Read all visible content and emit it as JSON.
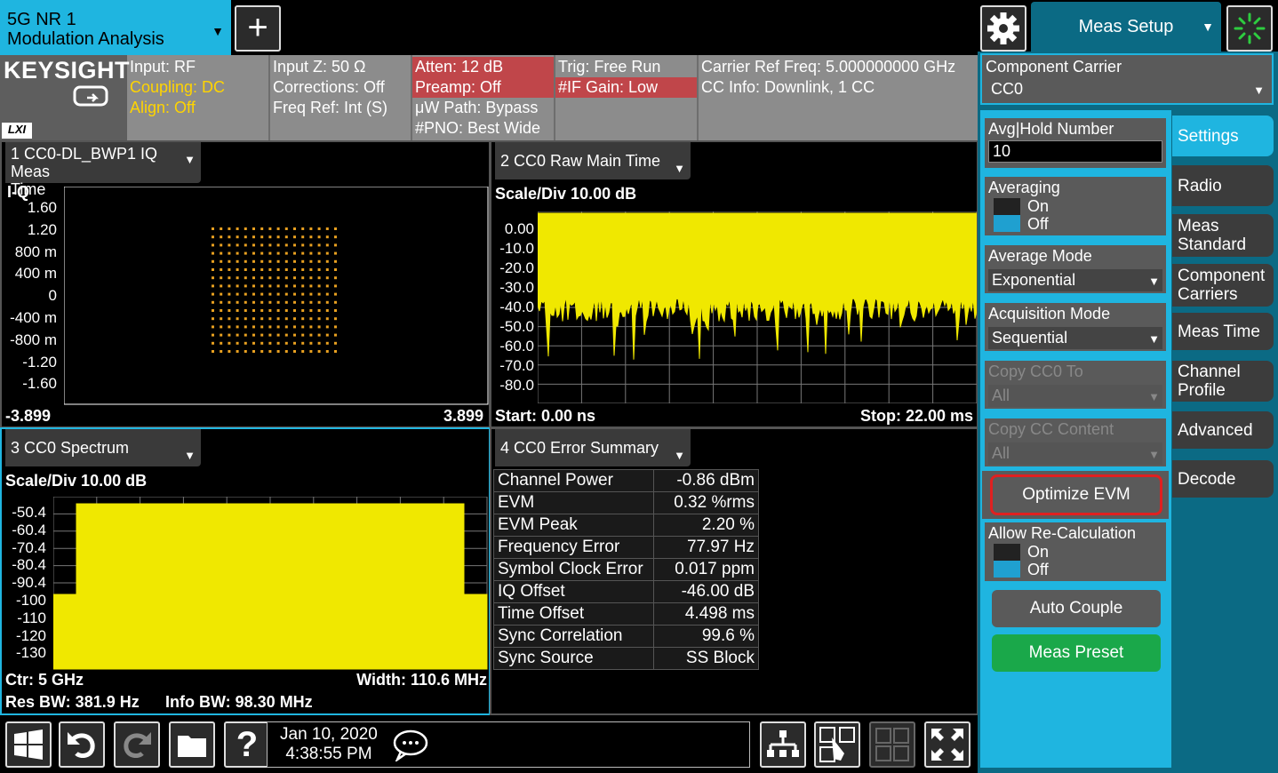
{
  "app": {
    "line1": "5G NR 1",
    "line2": "Modulation Analysis"
  },
  "header": {
    "meas_setup": "Meas Setup"
  },
  "logo": {
    "brand": "KEYSIGHT",
    "lxi": "LXI"
  },
  "info": {
    "input": "Input: RF",
    "coupling": "Coupling: DC",
    "align": "Align: Off",
    "input_z": "Input Z: 50 Ω",
    "corrections": "Corrections: Off",
    "freq_ref": "Freq Ref: Int (S)",
    "atten": "Atten: 12 dB",
    "preamp": "Preamp: Off",
    "uw_path": "μW Path: Bypass",
    "pno": "#PNO: Best Wide",
    "trig": "Trig: Free Run",
    "if_gain": "#IF Gain: Low",
    "carrier_ref": "Carrier Ref Freq: 5.000000000 GHz",
    "cc_info": "CC Info: Downlink, 1 CC"
  },
  "panel1": {
    "title1": "1 CC0-DL_BWP1  IQ Meas",
    "title2": "Time",
    "label": "I-Q",
    "yticks": [
      "1.60",
      "1.20",
      "800 m",
      "400 m",
      "0",
      "-400 m",
      "-800 m",
      "-1.20",
      "-1.60"
    ],
    "xmin": "-3.899",
    "xmax": "3.899"
  },
  "panel2": {
    "title": "2 CC0 Raw Main Time",
    "scale": "Scale/Div 10.00 dB",
    "yticks": [
      "0.00",
      "-10.0",
      "-20.0",
      "-30.0",
      "-40.0",
      "-50.0",
      "-60.0",
      "-70.0",
      "-80.0"
    ],
    "start": "Start: 0.00 ns",
    "stop": "Stop: 22.00 ms"
  },
  "panel3": {
    "title": "3 CC0 Spectrum",
    "scale": "Scale/Div 10.00 dB",
    "yticks": [
      "-50.4",
      "-60.4",
      "-70.4",
      "-80.4",
      "-90.4",
      "-100",
      "-110",
      "-120",
      "-130"
    ],
    "ctr": "Ctr: 5 GHz",
    "width": "Width: 110.6 MHz",
    "res_bw": "Res BW: 381.9 Hz",
    "info_bw": "Info BW: 98.30 MHz"
  },
  "panel4": {
    "title": "4 CC0 Error Summary",
    "rows": [
      [
        "Channel Power",
        "-0.86 dBm"
      ],
      [
        "EVM",
        "0.32 %rms"
      ],
      [
        "EVM Peak",
        "2.20 %"
      ],
      [
        "Frequency Error",
        "77.97 Hz"
      ],
      [
        "Symbol Clock Error",
        "0.017 ppm"
      ],
      [
        "IQ Offset",
        "-46.00 dB"
      ],
      [
        "Time Offset",
        "4.498 ms"
      ],
      [
        "Sync Correlation",
        "99.6 %"
      ],
      [
        "Sync Source",
        "SS Block"
      ]
    ]
  },
  "setup": {
    "cc_label": "Component Carrier",
    "cc_value": "CC0",
    "avg_label": "Avg|Hold Number",
    "avg_value": "10",
    "averaging": "Averaging",
    "on": "On",
    "off": "Off",
    "avg_mode_label": "Average Mode",
    "avg_mode_value": "Exponential",
    "acq_label": "Acquisition Mode",
    "acq_value": "Sequential",
    "copy_cc0_label": "Copy CC0 To",
    "copy_cc0_value": "All",
    "copy_cc_label": "Copy CC Content",
    "copy_cc_value": "All",
    "optimize": "Optimize EVM",
    "allow_recalc": "Allow Re-Calculation",
    "auto_couple": "Auto Couple",
    "meas_preset": "Meas Preset"
  },
  "tabs": [
    "Settings",
    "Radio",
    "Meas Standard",
    "Component Carriers",
    "Meas Time",
    "Channel Profile",
    "Advanced",
    "Decode"
  ],
  "status": {
    "date": "Jan 10, 2020",
    "time": "4:38:55 PM"
  },
  "colors": {
    "accent": "#1fb5e0",
    "trace": "#f0e800",
    "constellation": "#e8a020",
    "preset": "#1aa84a",
    "highlight": "#e02020"
  }
}
